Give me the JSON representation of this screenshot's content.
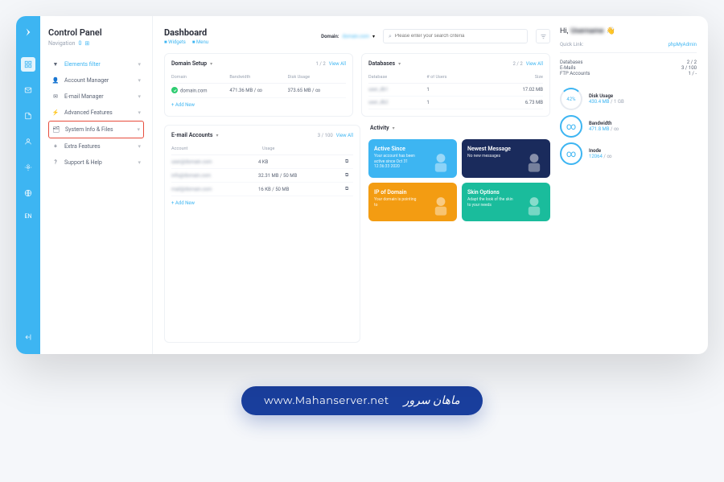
{
  "rail": {
    "lang": "EN"
  },
  "sidebar": {
    "title": "Control Panel",
    "nav_label": "Navigation",
    "nav_count": "0",
    "items": [
      {
        "label": "Elements filter",
        "blue": true
      },
      {
        "label": "Account Manager"
      },
      {
        "label": "E-mail Manager"
      },
      {
        "label": "Advanced Features"
      },
      {
        "label": "System Info & Files",
        "highlighted": true
      },
      {
        "label": "Extra Features"
      },
      {
        "label": "Support & Help"
      }
    ]
  },
  "header": {
    "title": "Dashboard",
    "widgets": "Widgets",
    "menu": "Menu",
    "domain_label": "Domain:",
    "domain_value": "domain.com",
    "search_placeholder": "Please enter your search criteria"
  },
  "domain_setup": {
    "title": "Domain Setup",
    "paging": "1 / 2",
    "view_all": "View All",
    "cols": [
      "Domain",
      "Bandwidth",
      "Disk Usage"
    ],
    "rows": [
      {
        "domain": "domain.com",
        "bw": "471.36 MB / ∞",
        "du": "373.65 MB / ∞"
      }
    ],
    "add_new": "+ Add New"
  },
  "databases": {
    "title": "Databases",
    "paging": "2 / 2",
    "view_all": "View All",
    "cols": [
      "Database",
      "# of Users",
      "Size"
    ],
    "rows": [
      {
        "db": "user_db1",
        "users": "1",
        "size": "17.02 MB"
      },
      {
        "db": "user_db2",
        "users": "1",
        "size": "6.73 MB"
      }
    ]
  },
  "email": {
    "title": "E-mail Accounts",
    "paging": "3 / 100",
    "view_all": "View All",
    "cols": [
      "Account",
      "Usage"
    ],
    "rows": [
      {
        "acct": "user@domain.com",
        "usage": "4 KB"
      },
      {
        "acct": "info@domain.com",
        "usage": "32.31 MB / 50 MB"
      },
      {
        "acct": "mail@domain.com",
        "usage": "16 KB / 50 MB"
      }
    ],
    "add_new": "+ Add New"
  },
  "activity": {
    "title": "Activity",
    "tiles": [
      {
        "k": "as",
        "title": "Active Since",
        "sub": "Your account has been active since Oct 31 12:36:33 2020"
      },
      {
        "k": "nm",
        "title": "Newest Message",
        "sub": "No new messages"
      },
      {
        "k": "ip",
        "title": "IP of Domain",
        "sub": "Your domain is pointing to"
      },
      {
        "k": "so",
        "title": "Skin Options",
        "sub": "Adapt the look of the skin to your needs"
      }
    ]
  },
  "right": {
    "greet_hi": "Hi,",
    "greet_name": "Username",
    "quick_link_label": "Quick Link:",
    "quick_link_value": "phpMyAdmin",
    "stats": [
      {
        "k": "Databases",
        "v": "2 / 2"
      },
      {
        "k": "E-Mails",
        "v": "3 / 100"
      },
      {
        "k": "FTP Accounts",
        "v": "1 / -"
      }
    ],
    "gauges": [
      {
        "pct": "42%",
        "k": "Disk Usage",
        "v": "430.4 MB",
        "tot": " / 1 GB"
      },
      {
        "pct": "∞",
        "k": "Bandwidth",
        "v": "471.8 MB",
        "tot": " / ∞",
        "full": true
      },
      {
        "pct": "∞",
        "k": "Inode",
        "v": "12064",
        "tot": " / ∞",
        "full": true
      }
    ]
  },
  "footer": {
    "url": "www.Mahanserver.net",
    "logo": "ماهان سرور"
  }
}
